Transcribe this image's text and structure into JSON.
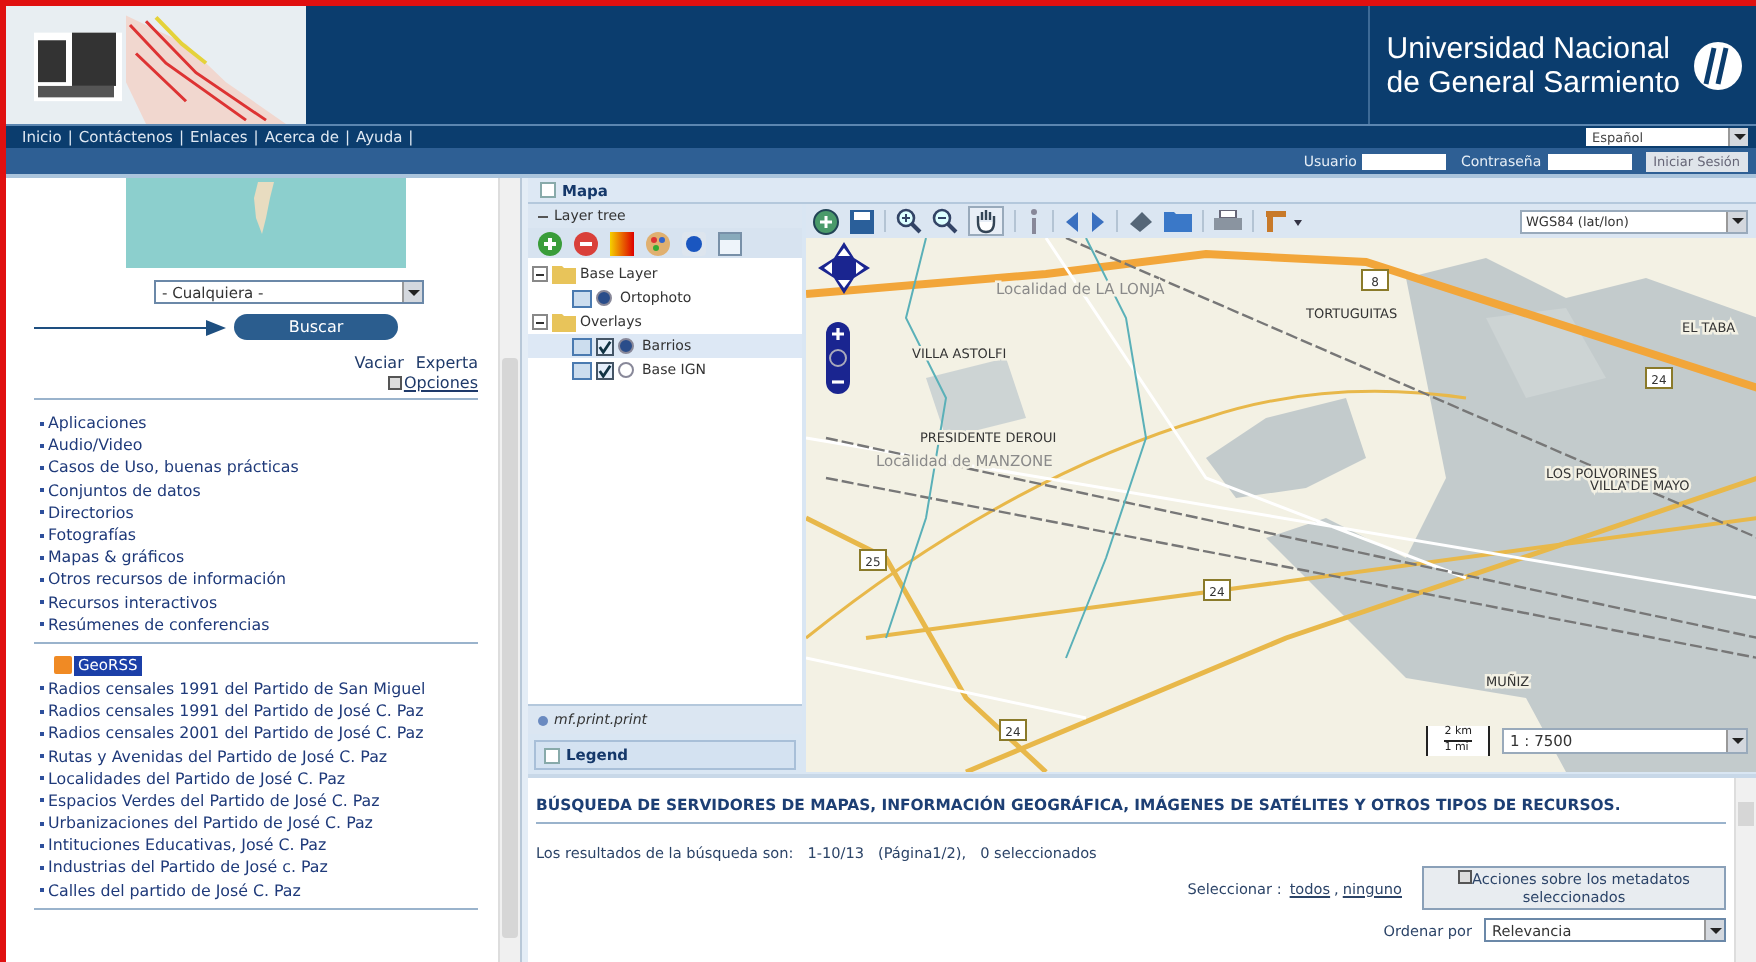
{
  "header": {
    "university": [
      "Universidad Nacional",
      "de General Sarmiento"
    ]
  },
  "nav": {
    "links": [
      "Inicio",
      "Contáctenos",
      "Enlaces",
      "Acerca de",
      "Ayuda"
    ],
    "separator": "|"
  },
  "language": "Español",
  "login": {
    "user_label": "Usuario",
    "password_label": "Contraseña",
    "button": "Iniciar Sesión"
  },
  "search": {
    "region": "- Cualquiera -",
    "button": "Buscar",
    "links": [
      "Vaciar",
      "Experta"
    ],
    "options": "Opciones"
  },
  "categories": [
    "Aplicaciones",
    "Audio/Video",
    "Casos de Uso, buenas prácticas",
    "Conjuntos de datos",
    "Directorios",
    "Fotografías",
    "Mapas & gráficos",
    "Otros recursos de información",
    "Recursos interactivos",
    "Resúmenes de conferencias"
  ],
  "georss": "GeoRSS",
  "feeds": [
    "Radios censales 1991 del Partido de San Miguel",
    "Radios censales 1991 del Partido de José C. Paz",
    "Radios censales 2001 del Partido de José C. Paz",
    "Rutas y Avenidas del Partido de José C. Paz",
    "Localidades del Partido de José C. Paz",
    "Espacios Verdes del Partido de José C. Paz",
    "Urbanizaciones del Partido de José C. Paz",
    "Intituciones Educativas, José C. Paz",
    "Industrias del Partido de José c. Paz",
    "Calles del partido de José C. Paz"
  ],
  "map_panel": {
    "title": "Mapa",
    "layer_tree": {
      "title": "Layer tree",
      "nodes": [
        {
          "label": "Base Layer",
          "expanded": true,
          "children": [
            {
              "label": "Ortophoto",
              "kind": "radio",
              "active": true,
              "selected": false
            }
          ]
        },
        {
          "label": "Overlays",
          "expanded": true,
          "children": [
            {
              "label": "Barrios",
              "kind": "check",
              "checked": true,
              "active": true,
              "selected": true
            },
            {
              "label": "Base IGN",
              "kind": "check",
              "checked": true,
              "active": false,
              "selected": false
            }
          ]
        }
      ]
    },
    "print_title": "mf.print.print",
    "legend_title": "Legend",
    "projection": "WGS84 (lat/lon)",
    "scale": "1 : 7500",
    "scale_bar": [
      "2 km",
      "1 mi"
    ],
    "map_labels": [
      {
        "text": "Localidad de LA LONJA",
        "kind": "area"
      },
      {
        "text": "VILLA ASTOLFI",
        "kind": "place"
      },
      {
        "text": "TORTUGUITAS",
        "kind": "place"
      },
      {
        "text": "PRESIDENTE DEROUI",
        "kind": "place"
      },
      {
        "text": "Localidad de MANZONE",
        "kind": "area"
      },
      {
        "text": "EL TABA",
        "kind": "place"
      },
      {
        "text": "LOS POLVORINES",
        "kind": "place"
      },
      {
        "text": "VILLA DE MAYO",
        "kind": "place"
      },
      {
        "text": "MUÑIZ",
        "kind": "place"
      },
      {
        "text": "8",
        "kind": "route"
      },
      {
        "text": "24",
        "kind": "route"
      },
      {
        "text": "25",
        "kind": "route"
      },
      {
        "text": "24",
        "kind": "route"
      },
      {
        "text": "24",
        "kind": "route"
      }
    ]
  },
  "results": {
    "title": "BÚSQUEDA DE SERVIDORES DE MAPAS, INFORMACIÓN GEOGRÁFICA, IMÁGENES DE SATÉLITES Y OTROS TIPOS DE RECURSOS.",
    "summary_label": "Los resultados de la búsqueda son:",
    "range": "1-10/13",
    "page": "(Página1/2),",
    "selected": "0 seleccionados",
    "select_label": "Seleccionar :",
    "select_all": "todos",
    "select_separator": ",",
    "select_none": "ninguno",
    "actions": "Acciones sobre los metadatos seleccionados",
    "sort_label": "Ordenar por",
    "sort": "Relevancia"
  }
}
